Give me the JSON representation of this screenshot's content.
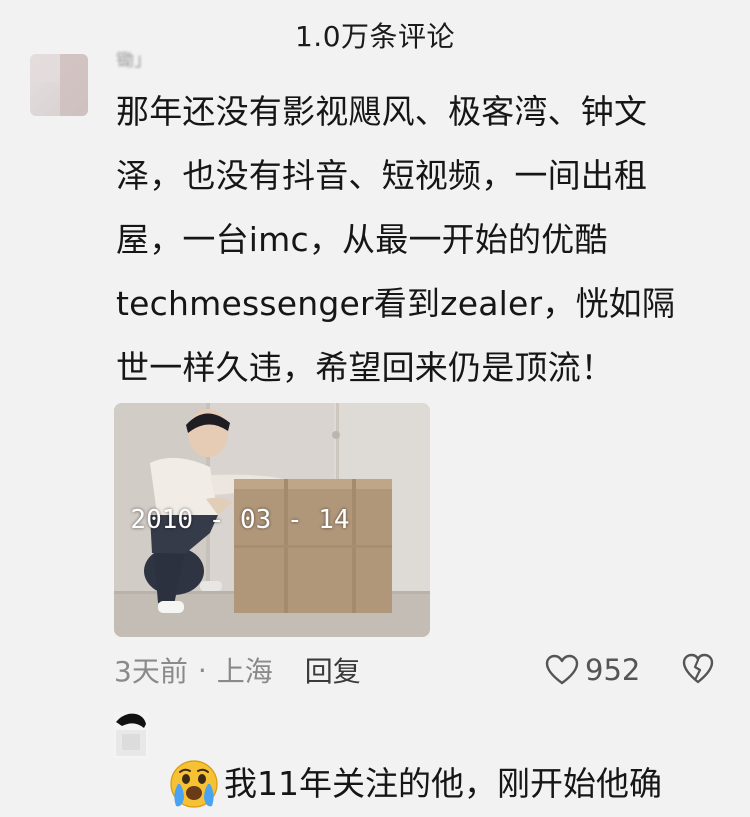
{
  "header": {
    "title": "1.0万条评论"
  },
  "comments": [
    {
      "username": "锄」",
      "text": "那年还没有影视飓风、极客湾、钟文泽，也没有抖音、短视频，一间出租屋，一台imc，从最一开始的优酷techmessenger看到zealer，恍如隔世一样久违，希望回来仍是顶流！",
      "text_lines": [
        "那年还没有影视飓风、极客湾、钟文",
        "泽，也没有抖音、短视频，一间出租",
        "屋，一台imc，从最一开始的优酷",
        "techmessenger看到zealer，恍如隔",
        "世一样久违，希望回来仍是顶流！"
      ],
      "video_date": "2010 - 03 - 14",
      "time": "3天前",
      "dot": "·",
      "location": "上海",
      "reply_label": "回复",
      "likes": "952",
      "icons": {
        "like": "heart-outline-icon",
        "dislike": "broken-heart-icon"
      }
    },
    {
      "text": "我11年关注的他，刚开始他确",
      "emoji": "crying-face-emoji"
    }
  ],
  "colors": {
    "background": "#f2f2f2",
    "text": "#161616",
    "meta": "#8a8a8a"
  }
}
